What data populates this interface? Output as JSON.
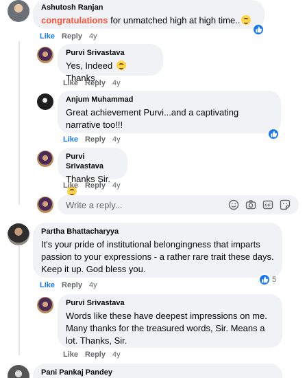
{
  "comments": [
    {
      "author": "Ashutosh Ranjan",
      "text_highlight": "congratulations",
      "text_rest": " for unmatched high at high time..",
      "emoji": "smiling-face-emoji",
      "like_label": "Like",
      "reply_label": "Reply",
      "time": "4y",
      "liked": true
    },
    {
      "author": "Purvi Srivastava",
      "text_before": "Yes, Indeed ",
      "text_after": " Thanks.",
      "emoji": "smiling-face-emoji",
      "like_label": "Like",
      "reply_label": "Reply",
      "time": "4y"
    },
    {
      "author": "Anjum Muhammad",
      "text": "Great achievement Purvi...and a captivating narrative too!!!",
      "like_label": "Like",
      "reply_label": "Reply",
      "time": "4y",
      "liked": true,
      "reaction": "like-reaction-icon"
    },
    {
      "author": "Purvi Srivastava",
      "text_before": "Thanks Sir. ",
      "emoji": "smiling-face-emoji",
      "like_label": "Like",
      "reply_label": "Reply",
      "time": "4y"
    },
    {
      "author": "Partha Bhattacharyya",
      "text": "It's your pride of institutional belongingness that imparts passion to your expressions - a rather rare trait these days. Keep it up. God bless you.",
      "like_label": "Like",
      "reply_label": "Reply",
      "time": "4y",
      "liked": true,
      "reaction": "like-reaction-icon",
      "reaction_count": "5"
    },
    {
      "author": "Purvi Srivastava",
      "text": "Words like these have deepest impressions on me. Many thanks for the treasured words, Sir. Means a lot. Thanks, Sir.",
      "like_label": "Like",
      "reply_label": "Reply",
      "time": "4y"
    },
    {
      "author": "Pani Pankaj Pandey"
    }
  ],
  "reply_box": {
    "placeholder": "Write a reply...",
    "tools": [
      "emoji-icon",
      "camera-icon",
      "gif-icon",
      "sticker-icon"
    ]
  },
  "colors": {
    "bubble": "#f0f2f5",
    "like_active": "#1877f2",
    "highlight": "#f5533d",
    "meta": "#65676b"
  }
}
